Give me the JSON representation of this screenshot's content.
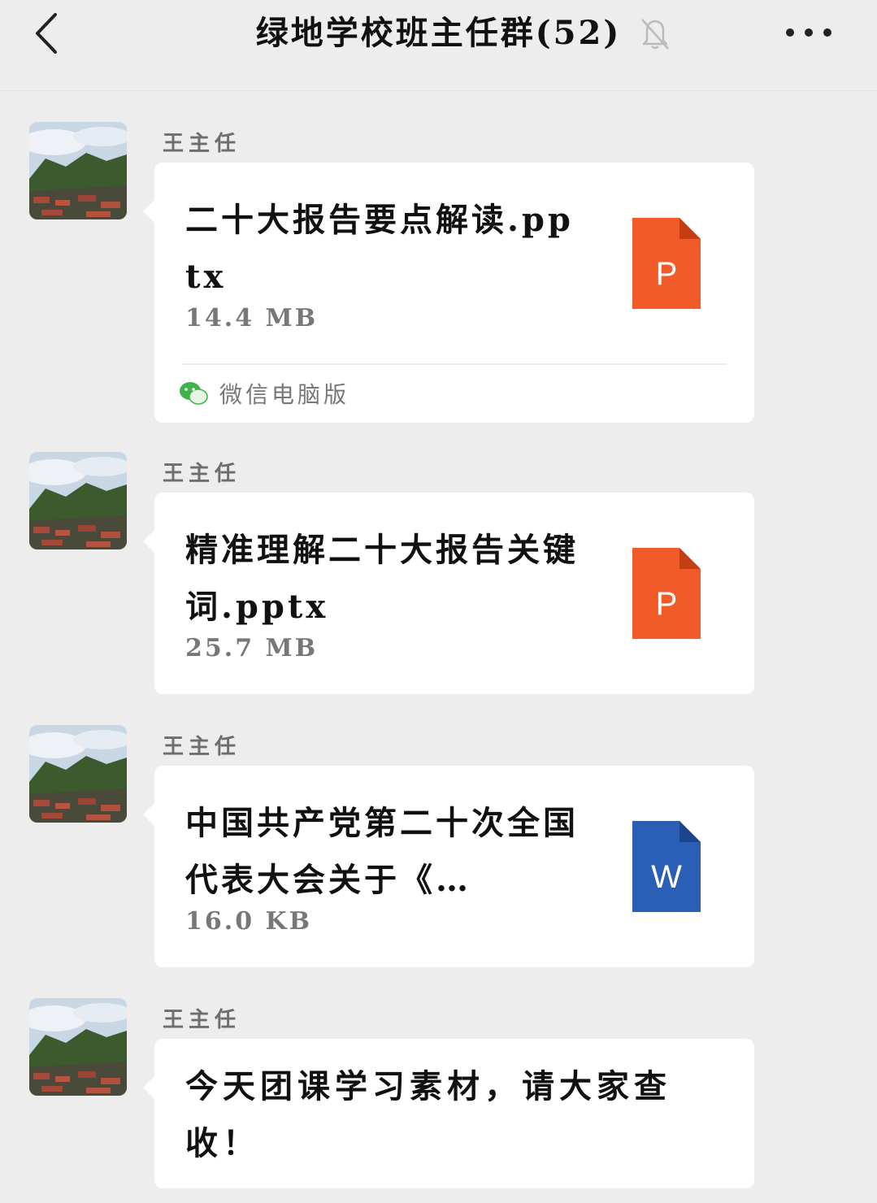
{
  "header": {
    "title": "绿地学校班主任群(52)",
    "back_icon": "chevron-left-icon",
    "mute_icon": "bell-off-icon",
    "more_icon": "more-dots-icon"
  },
  "messages": [
    {
      "sender": "王主任",
      "type": "file",
      "file_name": "二十大报告要点解读.pptx",
      "file_size": "14.4 MB",
      "file_type": "P",
      "file_color": "#f15a29",
      "source": "微信电脑版"
    },
    {
      "sender": "王主任",
      "type": "file",
      "file_name": "精准理解二十大报告关键词.pptx",
      "file_size": "25.7 MB",
      "file_type": "P",
      "file_color": "#f15a29"
    },
    {
      "sender": "王主任",
      "type": "file",
      "file_name": "中国共产党第二十次全国代表大会关于《…",
      "file_size": "16.0 KB",
      "file_type": "W",
      "file_color": "#2b5fb5"
    },
    {
      "sender": "王主任",
      "type": "text",
      "text": "今天团课学习素材，请大家查收！"
    }
  ]
}
